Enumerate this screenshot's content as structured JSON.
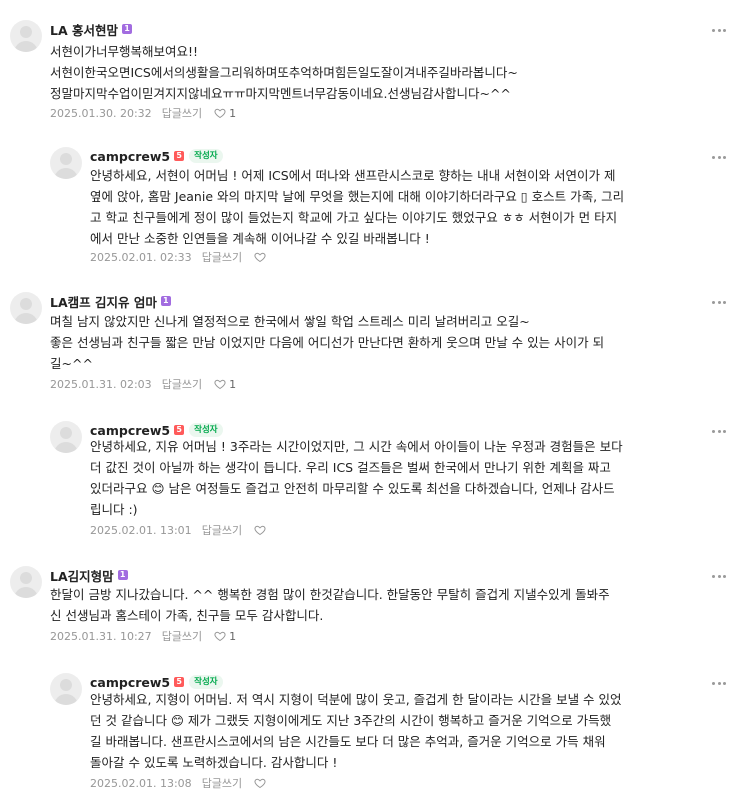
{
  "comments": [
    {
      "nickname": "LA 홍서현맘",
      "level_badge": "1",
      "lines": [
        "서현이가너무행복해보여요!!",
        "서현이한국오면ICS에서의생활을그리워하며또추억하며힘든일도잘이겨내주길바라봅니다~",
        "정말마지막수업이믿겨지지않네요ㅠㅠ마지막멘트너무감동이네요.선생님감사합니다~^^"
      ],
      "date": "2025.01.30. 20:32",
      "reply_label": "답글쓰기",
      "like_count": "1"
    },
    {
      "nickname": "campcrew5",
      "level_badge": "5",
      "writer_badge": "작성자",
      "lines": [
        "안녕하세요, 서현이 어머님 ! 어제 ICS에서 떠나와 샌프란시스코로 향하는 내내 서현이와 서연이가 제",
        "옆에 앉아, 홈맘 Jeanie 와의 마지막 날에 무엇을 했는지에 대해 이야기하더라구요 ▯ 호스트 가족, 그리",
        "고 학교 친구들에게 정이 많이 들었는지 학교에 가고 싶다는 이야기도 했었구요 ㅎㅎ 서현이가 먼 타지",
        "에서 만난 소중한 인연들을 계속해 이어나갈 수 있길 바래봅니다 !"
      ],
      "date": "2025.02.01. 02:33",
      "reply_label": "답글쓰기"
    },
    {
      "nickname": "LA캠프 김지유 엄마",
      "level_badge": "1",
      "lines": [
        "며칠 남지 않았지만 신나게 열정적으로 한국에서 쌓일 학업 스트레스 미리 날려버리고 오길~",
        "좋은 선생님과 친구들 짧은 만남 이었지만 다음에 어디선가 만난다면 환하게 웃으며 만날 수 있는 사이가 되",
        "길~^^"
      ],
      "date": "2025.01.31. 02:03",
      "reply_label": "답글쓰기",
      "like_count": "1"
    },
    {
      "nickname": "campcrew5",
      "level_badge": "5",
      "writer_badge": "작성자",
      "lines": [
        "안녕하세요, 지유 어머님 ! 3주라는 시간이었지만, 그 시간 속에서 아이들이 나눈 우정과 경험들은 보다",
        "더 값진 것이 아닐까 하는 생각이 듭니다. 우리 ICS 걸즈들은 벌써 한국에서 만나기 위한 계획을 짜고",
        "있더라구요 😊 남은 여정들도 즐겁고 안전히 마무리할 수 있도록 최선을 다하겠습니다, 언제나 감사드",
        "립니다 :)"
      ],
      "date": "2025.02.01. 13:01",
      "reply_label": "답글쓰기"
    },
    {
      "nickname": "LA김지형맘",
      "level_badge": "1",
      "lines": [
        "한달이 금방 지나갔습니다. ^^ 행복한 경험 많이 한것같습니다. 한달동안 무탈히 즐겁게 지낼수있게 돌봐주",
        "신 선생님과 홈스테이 가족, 친구들 모두 감사합니다."
      ],
      "date": "2025.01.31. 10:27",
      "reply_label": "답글쓰기",
      "like_count": "1"
    },
    {
      "nickname": "campcrew5",
      "level_badge": "5",
      "writer_badge": "작성자",
      "lines": [
        "안녕하세요, 지형이 어머님. 저 역시 지형이 덕분에 많이 웃고, 즐겁게 한 달이라는 시간을 보낼 수 있었",
        "던 것 같습니다 😊 제가 그랬듯 지형이에게도 지난 3주간의 시간이 행복하고 즐거운 기억으로 가득했",
        "길 바래봅니다. 샌프란시스코에서의 남은 시간들도 보다 더 많은 추억과, 즐거운 기억으로 가득 채워",
        "돌아갈 수 있도록 노력하겠습니다. 감사합니다 !"
      ],
      "date": "2025.02.01. 13:08",
      "reply_label": "답글쓰기"
    }
  ],
  "colors": {
    "writer_badge_text": "#03a94d",
    "writer_badge_bg": "#ebf7ef",
    "member_level": "#a26ce0",
    "staff_level": "#ff5a5a",
    "meta_text": "#979797"
  },
  "icons": {
    "more": "more-dots-icon",
    "like": "heart-icon"
  }
}
